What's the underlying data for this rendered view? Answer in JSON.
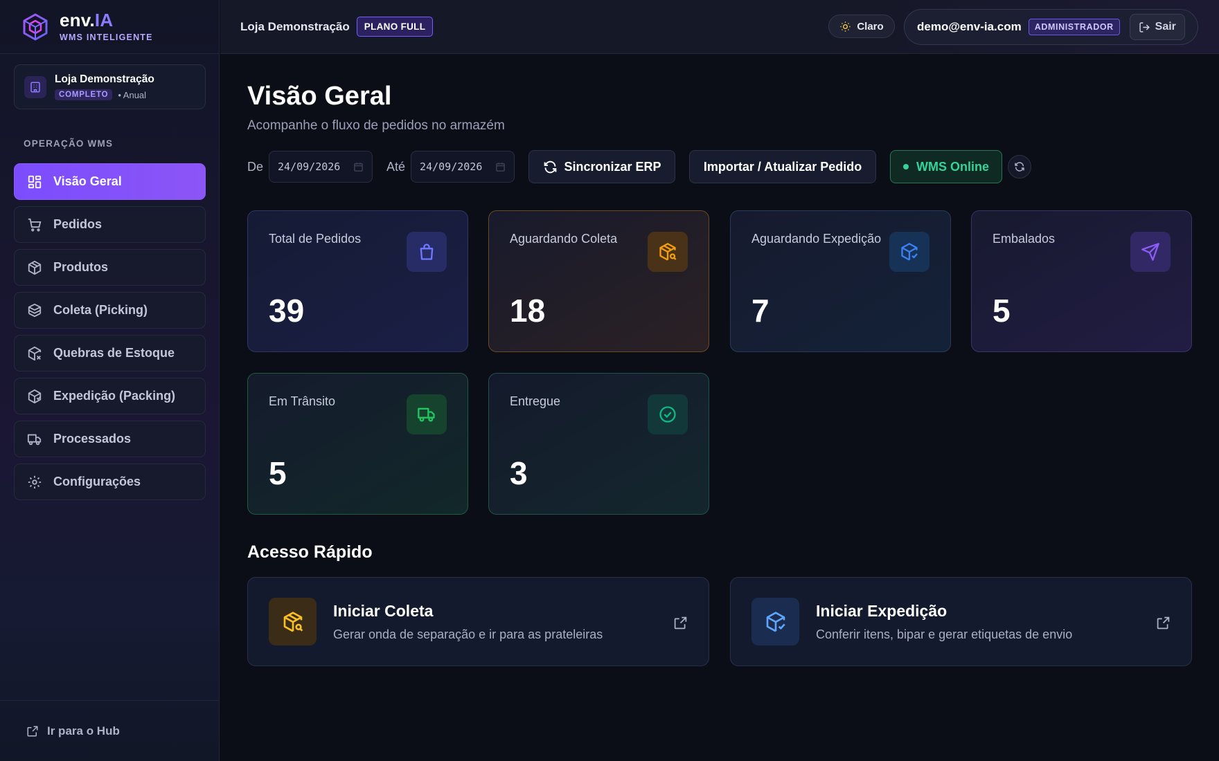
{
  "brand": {
    "name_main": "env.",
    "name_accent": "IA",
    "subtitle": "WMS INTELIGENTE"
  },
  "store_card": {
    "name": "Loja Demonstração",
    "badge": "COMPLETO",
    "period": "• Anual"
  },
  "sidebar": {
    "section_label": "OPERAÇÃO WMS",
    "items": [
      {
        "label": "Visão Geral",
        "icon": "dashboard-icon",
        "active": true
      },
      {
        "label": "Pedidos",
        "icon": "cart-icon"
      },
      {
        "label": "Produtos",
        "icon": "box-icon"
      },
      {
        "label": "Coleta (Picking)",
        "icon": "boxes-icon"
      },
      {
        "label": "Quebras de Estoque",
        "icon": "box-x-icon"
      },
      {
        "label": "Expedição (Packing)",
        "icon": "package-icon"
      },
      {
        "label": "Processados",
        "icon": "truck-icon"
      },
      {
        "label": "Configurações",
        "icon": "gear-icon"
      }
    ],
    "footer_link": "Ir para o Hub"
  },
  "topbar": {
    "store_name": "Loja Demonstração",
    "plan_badge": "PLANO FULL",
    "theme_label": "Claro",
    "user_email": "demo@env-ia.com",
    "role_badge": "ADMINISTRADOR",
    "logout_label": "Sair"
  },
  "main": {
    "title": "Visão Geral",
    "subtitle": "Acompanhe o fluxo de pedidos no armazém",
    "filters": {
      "from_label": "De",
      "from_value": "24/09/2026",
      "to_label": "Até",
      "to_value": "24/09/2026"
    },
    "buttons": {
      "sync": "Sincronizar ERP",
      "import": "Importar / Atualizar Pedido",
      "status": "WMS Online"
    },
    "stats": {
      "total": {
        "label": "Total de Pedidos",
        "value": "39",
        "icon": "bag-icon",
        "color": "#6366f1"
      },
      "coleta": {
        "label": "Aguardando Coleta",
        "value": "18",
        "icon": "box-search-icon",
        "color": "#f59e0b"
      },
      "expedicao": {
        "label": "Aguardando Expedição",
        "value": "7",
        "icon": "box-check-icon",
        "color": "#3b82f6"
      },
      "embalados": {
        "label": "Embalados",
        "value": "5",
        "icon": "send-icon",
        "color": "#8b5cf6"
      },
      "transito": {
        "label": "Em Trânsito",
        "value": "5",
        "icon": "truck-icon",
        "color": "#22c55e"
      },
      "entregue": {
        "label": "Entregue",
        "value": "3",
        "icon": "check-circle-icon",
        "color": "#10b981"
      }
    },
    "quick_access": {
      "title": "Acesso Rápido",
      "items": [
        {
          "title": "Iniciar Coleta",
          "desc": "Gerar onda de separação e ir para as prateleiras",
          "icon": "box-search-icon"
        },
        {
          "title": "Iniciar Expedição",
          "desc": "Conferir itens, bipar e gerar etiquetas de envio",
          "icon": "box-check-icon"
        }
      ]
    }
  }
}
